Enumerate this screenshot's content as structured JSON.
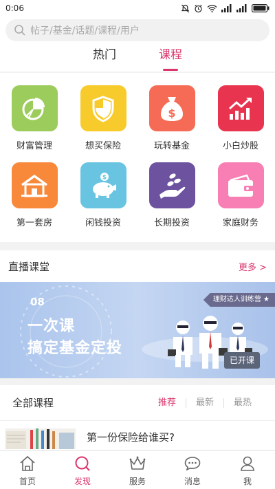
{
  "status": {
    "time": "0:06"
  },
  "search": {
    "placeholder": "帖子/基金/话题/课程/用户",
    "icon": "search-icon"
  },
  "tabs": [
    {
      "label": "热门",
      "active": false
    },
    {
      "label": "课程",
      "active": true
    }
  ],
  "categories": [
    {
      "label": "财富管理",
      "icon": "pie-chart-icon",
      "color": "#9ccc5b"
    },
    {
      "label": "想买保险",
      "icon": "shield-icon",
      "color": "#f8cb2c"
    },
    {
      "label": "玩转基金",
      "icon": "money-bag-icon",
      "color": "#f56b55"
    },
    {
      "label": "小白炒股",
      "icon": "trend-chart-icon",
      "color": "#e8344e"
    },
    {
      "label": "第一套房",
      "icon": "house-icon",
      "color": "#f9893a"
    },
    {
      "label": "闲钱投资",
      "icon": "piggy-bank-icon",
      "color": "#68c4e1"
    },
    {
      "label": "长期投资",
      "icon": "coins-hand-icon",
      "color": "#6d52a0"
    },
    {
      "label": "家庭财务",
      "icon": "wallet-icon",
      "color": "#f77fb3"
    }
  ],
  "live": {
    "title": "直播课堂",
    "more": "更多 >",
    "banner": {
      "number": "08",
      "line1": "一次课",
      "line2": "搞定基金定投",
      "ribbon": "理财达人训练营 ★",
      "badge": "已开课"
    }
  },
  "courses": {
    "title": "全部课程",
    "filters": [
      {
        "label": "推荐",
        "active": true
      },
      {
        "label": "最新",
        "active": false
      },
      {
        "label": "最热",
        "active": false
      }
    ],
    "items": [
      {
        "title": "第一份保险给谁买?"
      }
    ]
  },
  "nav": [
    {
      "label": "首页",
      "icon": "home-icon",
      "active": false
    },
    {
      "label": "发现",
      "icon": "discover-icon",
      "active": true
    },
    {
      "label": "服务",
      "icon": "crown-icon",
      "active": false
    },
    {
      "label": "消息",
      "icon": "message-icon",
      "active": false
    },
    {
      "label": "我",
      "icon": "profile-icon",
      "active": false
    }
  ],
  "colors": {
    "accent": "#d9356a",
    "banner": "#aac4ec"
  }
}
